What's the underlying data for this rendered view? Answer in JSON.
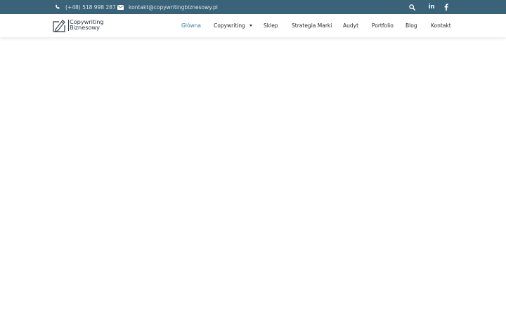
{
  "topbar": {
    "phone": "(+48) 518 998 287",
    "email": "kontakt@copywritingbiznesowy.pl",
    "linkedin_label": "in"
  },
  "logo": {
    "line1": "Copywriting",
    "line2": "Biznesowy"
  },
  "nav": {
    "items": [
      {
        "label": "Główna"
      },
      {
        "label": "Copywriting"
      },
      {
        "label": "Sklep"
      },
      {
        "label": "Strategia Marki"
      },
      {
        "label": "Audyt"
      },
      {
        "label": "Portfolio"
      },
      {
        "label": "Blog"
      },
      {
        "label": "Kontakt"
      }
    ]
  },
  "colors": {
    "topbar_bg": "#3a6379",
    "accent": "#3a7fa1",
    "text": "#2b2b2b"
  },
  "icons": [
    "phone-icon",
    "envelope-icon",
    "search-icon",
    "linkedin-icon",
    "facebook-icon",
    "pen-logo-icon",
    "caret-down-icon"
  ]
}
